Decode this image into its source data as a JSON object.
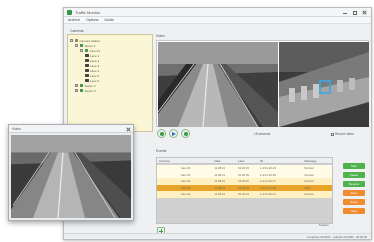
{
  "window": {
    "title": "Traffic Monitor",
    "status_text": "Longitude 00.0000 · Latitude 00.0000 · 00:00:00"
  },
  "menu": [
    "Archive",
    "Options",
    "Guide"
  ],
  "tree": {
    "header": "Cameras",
    "nodes": [
      {
        "label": "Camera Station",
        "depth": 0,
        "expander": "−",
        "icon_color": "#8a8a5a"
      },
      {
        "label": "Sector 1",
        "depth": 1,
        "expander": "−",
        "icon_color": "#3c9a4a"
      },
      {
        "label": "Cam 01",
        "depth": 2,
        "expander": "−",
        "icon_color": "#3c9a4a"
      },
      {
        "label": "Lane 1",
        "depth": 3,
        "expander": "",
        "icon_color": "#444444"
      },
      {
        "label": "Lane 2",
        "depth": 3,
        "expander": "",
        "icon_color": "#444444"
      },
      {
        "label": "Lane 3",
        "depth": 3,
        "expander": "",
        "icon_color": "#444444"
      },
      {
        "label": "Lane 4",
        "depth": 3,
        "expander": "",
        "icon_color": "#444444"
      },
      {
        "label": "Lane 5",
        "depth": 3,
        "expander": "",
        "icon_color": "#444444"
      },
      {
        "label": "Lane 6",
        "depth": 3,
        "expander": "",
        "icon_color": "#444444"
      },
      {
        "label": "Sector 2",
        "depth": 1,
        "expander": "+",
        "icon_color": "#3c9a4a"
      },
      {
        "label": "Sector 3",
        "depth": 1,
        "expander": "+",
        "icon_color": "#3c9a4a"
      }
    ]
  },
  "video": {
    "header": "Video",
    "caption_left": "15 seconds",
    "caption_right": "Record video"
  },
  "table": {
    "header": "Events",
    "columns": [
      "Camera",
      "Date",
      "Lane",
      "ID",
      "Message"
    ],
    "rows": [
      {
        "cells": [
          "Cam 01",
          "11.08.21",
          "01:02:33",
          "L-4 01-02-33",
          "Normal"
        ],
        "bg": "#fffbe6"
      },
      {
        "cells": [
          "Cam 01",
          "11.08.21",
          "01:02:35",
          "L-4 01-02-35",
          "Normal"
        ],
        "bg": "#fffbe6"
      },
      {
        "cells": [
          "Cam 01",
          "11.08.21",
          "01:02:37",
          "L-4 01-02-37",
          "Normal"
        ],
        "bg": "#fff1c2"
      },
      {
        "cells": [
          "Cam 01",
          "11.08.21",
          "01:02:39",
          "L-4 01-02-39",
          "Alert"
        ],
        "bg": "#e7a32a"
      },
      {
        "cells": [
          "Cam 01",
          "11.08.21",
          "01:02:41",
          "L-4 01-02-41",
          "Normal"
        ],
        "bg": "#fff1c2"
      }
    ],
    "count_label": "5 items"
  },
  "side_buttons": [
    {
      "label": "Start",
      "color": "#4fb24f"
    },
    {
      "label": "Pause",
      "color": "#4fb24f"
    },
    {
      "label": "Resume",
      "color": "#4fb24f"
    },
    {
      "label": "Alarm",
      "color": "#f08c2e"
    },
    {
      "label": "Reset",
      "color": "#f08c2e"
    },
    {
      "label": "Stop",
      "color": "#f08c2e"
    }
  ],
  "popup": {
    "title": "Video"
  },
  "colors": {
    "accent_green": "#3c9a4a",
    "tree_bg": "#fbf6d6",
    "highlight_row": "#e7a32a",
    "tracker_box": "#3aa7e8"
  }
}
